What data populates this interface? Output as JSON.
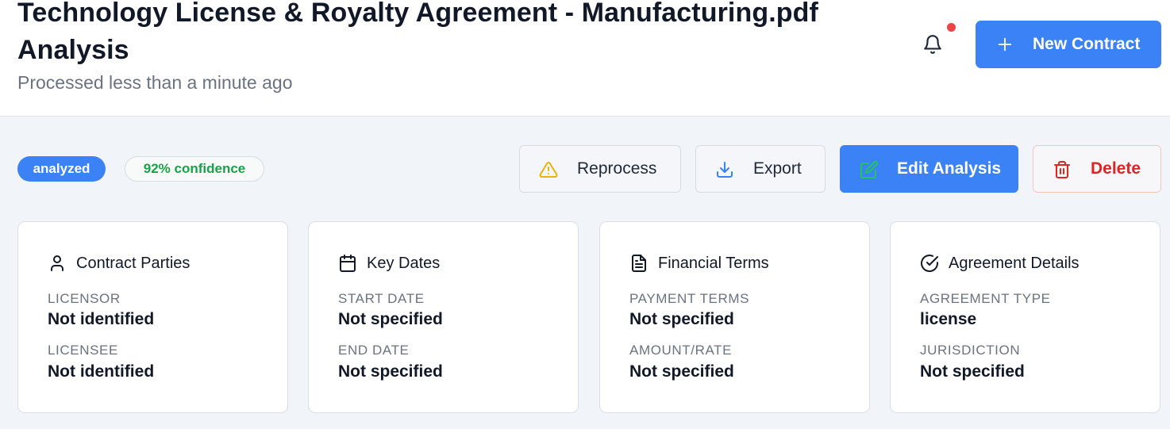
{
  "header": {
    "title": "Technology License & Royalty Agreement - Manufacturing.pdf Analysis",
    "subtitle": "Processed less than a minute ago",
    "new_contract_label": "New Contract"
  },
  "status": {
    "state_label": "analyzed",
    "confidence_label": "92% confidence"
  },
  "actions": {
    "reprocess_label": "Reprocess",
    "export_label": "Export",
    "edit_label": "Edit Analysis",
    "delete_label": "Delete"
  },
  "cards": [
    {
      "title": "Contract Parties",
      "icon": "user-icon",
      "fields": [
        {
          "label": "LICENSOR",
          "value": "Not identified"
        },
        {
          "label": "LICENSEE",
          "value": "Not identified"
        }
      ]
    },
    {
      "title": "Key Dates",
      "icon": "calendar-icon",
      "fields": [
        {
          "label": "START DATE",
          "value": "Not specified"
        },
        {
          "label": "END DATE",
          "value": "Not specified"
        }
      ]
    },
    {
      "title": "Financial Terms",
      "icon": "document-icon",
      "fields": [
        {
          "label": "PAYMENT TERMS",
          "value": "Not specified"
        },
        {
          "label": "AMOUNT/RATE",
          "value": "Not specified"
        }
      ]
    },
    {
      "title": "Agreement Details",
      "icon": "check-circle-icon",
      "fields": [
        {
          "label": "AGREEMENT TYPE",
          "value": "license"
        },
        {
          "label": "JURISDICTION",
          "value": "Not specified"
        }
      ]
    }
  ],
  "colors": {
    "primary": "#3b82f6",
    "success": "#16a34a",
    "danger": "#dc2626",
    "warning": "#eab308",
    "notification_dot": "#ef4444"
  }
}
